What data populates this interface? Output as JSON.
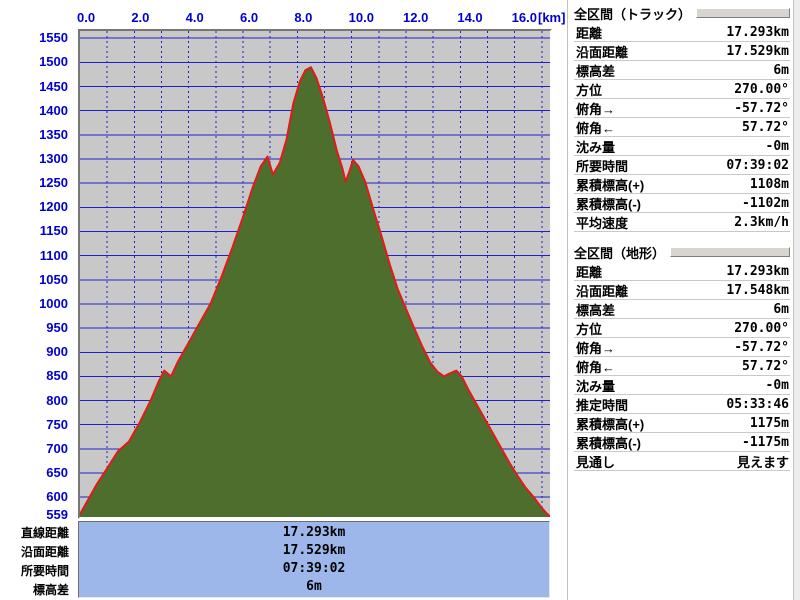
{
  "chart_data": {
    "type": "area",
    "title": "",
    "xlabel_unit": "[km]",
    "x_ticks": [
      "0.0",
      "2.0",
      "4.0",
      "6.0",
      "8.0",
      "10.0",
      "12.0",
      "14.0",
      "16.0"
    ],
    "x_tick_values_km": [
      0,
      2,
      4,
      6,
      8,
      10,
      12,
      14,
      16
    ],
    "x_minor_grid_km": 1,
    "x_range_km": [
      0,
      17.3
    ],
    "y_ticks": [
      "1550",
      "1500",
      "1450",
      "1400",
      "1350",
      "1300",
      "1250",
      "1200",
      "1150",
      "1100",
      "1050",
      "1000",
      "950",
      "900",
      "850",
      "800",
      "750",
      "700",
      "650",
      "600",
      "559"
    ],
    "y_grid_step_m": 50,
    "y_range_m": [
      559,
      1565
    ],
    "grid": true,
    "legend": false,
    "profile_x_km": [
      0,
      0.3,
      0.6,
      1.0,
      1.4,
      1.8,
      2.2,
      2.6,
      2.9,
      3.1,
      3.35,
      3.6,
      4.0,
      4.4,
      4.8,
      5.2,
      5.6,
      6.0,
      6.35,
      6.65,
      6.9,
      7.1,
      7.35,
      7.6,
      7.85,
      8.1,
      8.3,
      8.5,
      8.7,
      8.95,
      9.2,
      9.45,
      9.65,
      9.78,
      9.9,
      10.05,
      10.25,
      10.5,
      10.8,
      11.1,
      11.4,
      11.7,
      12.0,
      12.3,
      12.6,
      12.9,
      13.15,
      13.4,
      13.6,
      13.85,
      14.05,
      14.3,
      14.6,
      14.9,
      15.2,
      15.5,
      15.8,
      16.1,
      16.4,
      16.7,
      17.0,
      17.15,
      17.3
    ],
    "profile_elev_m": [
      565,
      595,
      625,
      660,
      695,
      715,
      755,
      800,
      840,
      862,
      850,
      880,
      920,
      960,
      1000,
      1055,
      1115,
      1180,
      1240,
      1285,
      1305,
      1268,
      1292,
      1340,
      1415,
      1462,
      1484,
      1490,
      1468,
      1425,
      1375,
      1318,
      1282,
      1253,
      1272,
      1298,
      1285,
      1252,
      1195,
      1140,
      1082,
      1030,
      990,
      950,
      912,
      878,
      860,
      850,
      856,
      862,
      850,
      822,
      792,
      762,
      732,
      702,
      672,
      645,
      620,
      600,
      578,
      568,
      560
    ],
    "colors": {
      "area_fill": "#4e6e2e",
      "line": "#e11b17",
      "grid": "#2020c8",
      "plot_bg": "#c8c8c8",
      "axis_text": "#0000d2"
    }
  },
  "summary_box": {
    "bg": "#9db7ea",
    "rows": [
      {
        "label": "直線距離",
        "value": "17.293km"
      },
      {
        "label": "沿面距離",
        "value": "17.529km"
      },
      {
        "label": "所要時間",
        "value": "07:39:02"
      },
      {
        "label": "標高差",
        "value": "6m"
      }
    ]
  },
  "panels": [
    {
      "title": "全区間（トラック）",
      "rows": [
        {
          "label": "距離",
          "value": "17.293km"
        },
        {
          "label": "沿面距離",
          "value": "17.529km"
        },
        {
          "label": "標高差",
          "value": "6m"
        },
        {
          "label": "方位",
          "value": "270.00°"
        },
        {
          "label": "俯角→",
          "value": "-57.72°"
        },
        {
          "label": "俯角←",
          "value": "57.72°"
        },
        {
          "label": "沈み量",
          "value": "-0m"
        },
        {
          "label": "所要時間",
          "value": "07:39:02"
        },
        {
          "label": "累積標高(+)",
          "value": "1108m"
        },
        {
          "label": "累積標高(-)",
          "value": "-1102m"
        },
        {
          "label": "平均速度",
          "value": "2.3km/h"
        }
      ]
    },
    {
      "title": "全区間（地形）",
      "rows": [
        {
          "label": "距離",
          "value": "17.293km"
        },
        {
          "label": "沿面距離",
          "value": "17.548km"
        },
        {
          "label": "標高差",
          "value": "6m"
        },
        {
          "label": "方位",
          "value": "270.00°"
        },
        {
          "label": "俯角→",
          "value": "-57.72°"
        },
        {
          "label": "俯角←",
          "value": "57.72°"
        },
        {
          "label": "沈み量",
          "value": "-0m"
        },
        {
          "label": "推定時間",
          "value": "05:33:46"
        },
        {
          "label": "累積標高(+)",
          "value": "1175m"
        },
        {
          "label": "累積標高(-)",
          "value": "-1175m"
        },
        {
          "label": "見通し",
          "value": "見えます"
        }
      ]
    }
  ]
}
